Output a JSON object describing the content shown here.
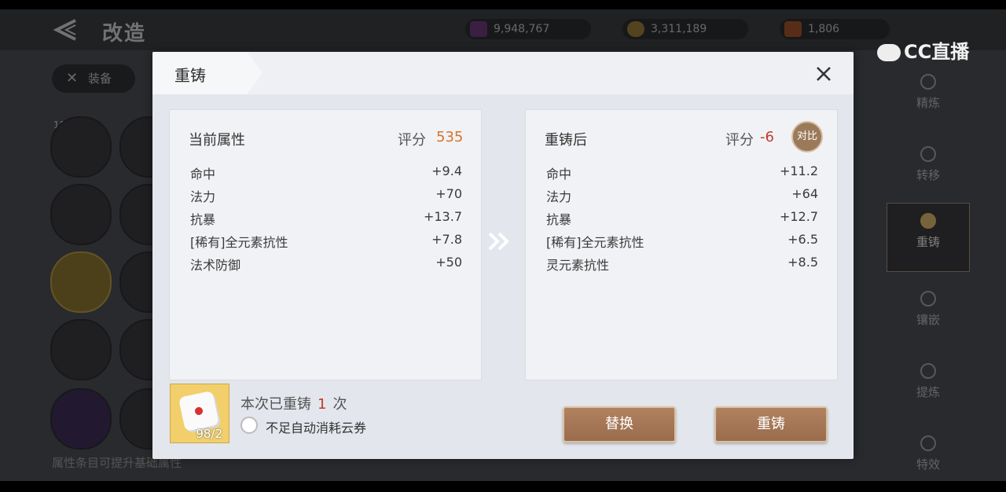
{
  "background": {
    "page_title": "改造",
    "currencies": [
      {
        "icon": "purple-gem-icon",
        "value": "9,948,767",
        "color": "#6a3a7a"
      },
      {
        "icon": "gold-coin-icon",
        "value": "3,311,189",
        "color": "#9a7a3a"
      },
      {
        "icon": "feather-icon",
        "value": "1,806",
        "color": "#a0522d"
      }
    ],
    "watermark": "CC直播",
    "equip_chip": "装备",
    "slot_level": "10",
    "bottom_hint": "属性条目可提升基础属性",
    "side_menu": [
      {
        "label": "精炼",
        "active": false
      },
      {
        "label": "转移",
        "active": false
      },
      {
        "label": "重铸",
        "active": true
      },
      {
        "label": "镶嵌",
        "active": false
      },
      {
        "label": "提炼",
        "active": false
      },
      {
        "label": "特效",
        "active": false
      }
    ]
  },
  "dialog": {
    "title": "重铸",
    "current": {
      "title": "当前属性",
      "score_label": "评分",
      "score_value": "535",
      "score_color": "#d4742c",
      "attributes": [
        {
          "name": "命中",
          "value": "+9.4"
        },
        {
          "name": "法力",
          "value": "+70"
        },
        {
          "name": "抗暴",
          "value": "+13.7"
        },
        {
          "name": "[稀有]全元素抗性",
          "value": "+7.8"
        },
        {
          "name": "法术防御",
          "value": "+50"
        }
      ]
    },
    "after": {
      "title": "重铸后",
      "score_label": "评分",
      "score_value": "-6",
      "score_color": "#c0392b",
      "compare_label": "对比",
      "attributes": [
        {
          "name": "命中",
          "value": "+11.2"
        },
        {
          "name": "法力",
          "value": "+64"
        },
        {
          "name": "抗暴",
          "value": "+12.7"
        },
        {
          "name": "[稀有]全元素抗性",
          "value": "+6.5"
        },
        {
          "name": "灵元素抗性",
          "value": "+8.5"
        }
      ]
    },
    "item_count": "98/2",
    "reforge_prefix": "本次已重铸",
    "reforge_times": "1",
    "reforge_suffix": "次",
    "auto_consume_label": "不足自动消耗云券",
    "replace_button": "替换",
    "reforge_button": "重铸"
  }
}
